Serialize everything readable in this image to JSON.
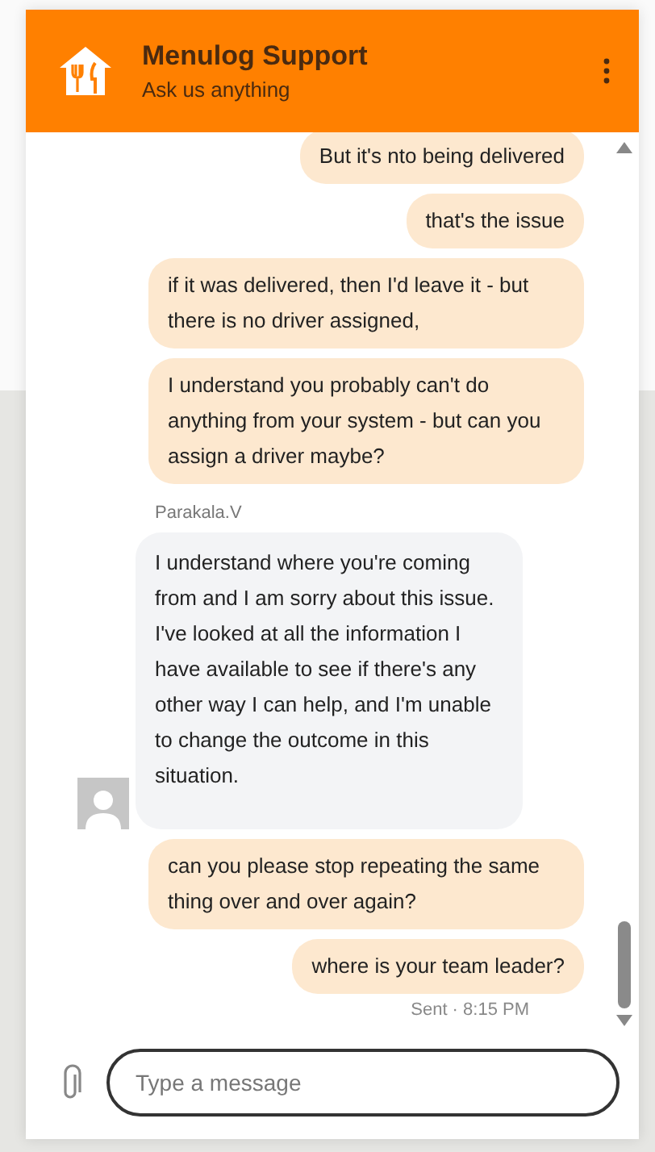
{
  "header": {
    "title": "Menulog Support",
    "subtitle": "Ask us anything"
  },
  "messages": [
    {
      "kind": "user",
      "text": "But it's nto being delivered"
    },
    {
      "kind": "user",
      "text": "that's the issue"
    },
    {
      "kind": "user",
      "text": "if it was delivered, then I'd leave it - but there is no driver assigned,"
    },
    {
      "kind": "user",
      "text": "I understand you probably can't do anything from your system - but can you assign a driver maybe?"
    },
    {
      "kind": "agent",
      "sender": "Parakala.V",
      "text": "I understand where you're coming from and I am sorry about this issue. I've looked at all the information I have available to see if there's any other way I can help, and I'm unable to change the outcome in this situation."
    },
    {
      "kind": "user",
      "text": "can you please stop repeating the same thing over and over again?"
    },
    {
      "kind": "user",
      "text": "where is your team leader?",
      "status": "Sent · 8:15 PM"
    }
  ],
  "composer": {
    "placeholder": "Type a message"
  }
}
